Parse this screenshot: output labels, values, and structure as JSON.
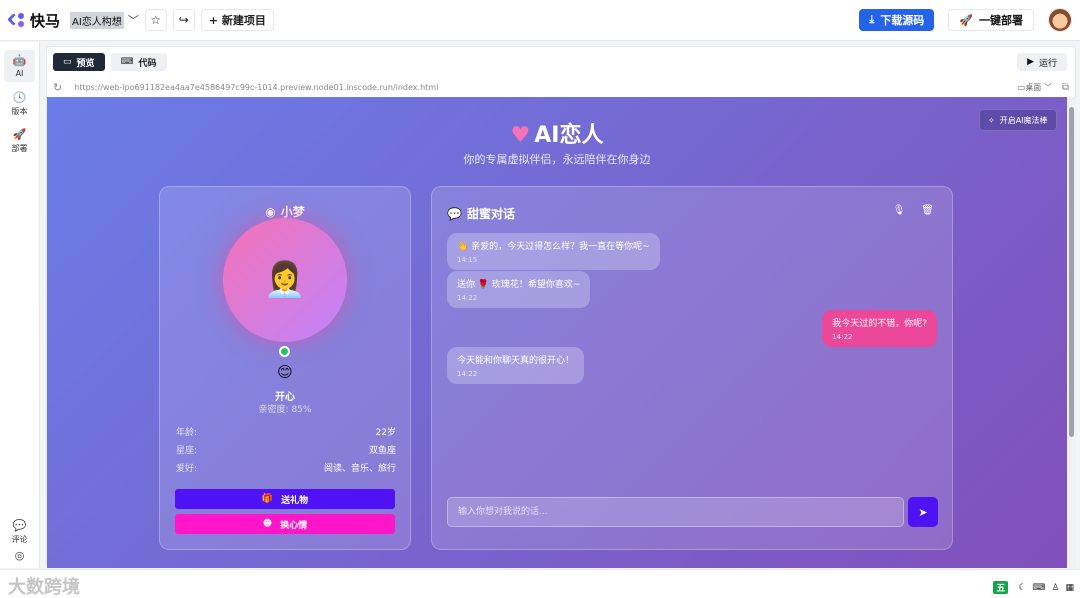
{
  "app": {
    "brand": "快马",
    "project_name": "AI恋人构想",
    "new_project": "+ 新建项目",
    "download": "下载源码",
    "deploy": "一键部署"
  },
  "rail": {
    "items": [
      {
        "label": "AI"
      },
      {
        "label": "版本"
      },
      {
        "label": "部署"
      },
      {
        "label": "评论"
      }
    ]
  },
  "editor": {
    "tabs": [
      {
        "label": "预览"
      },
      {
        "label": "代码"
      }
    ],
    "run": "运行",
    "url": "https://web-ipo691182ea4aa7e4586497c99c-1014.preview.node01.inscode.run/index.html",
    "device": "桌面"
  },
  "page": {
    "title": "AI恋人",
    "subtitle": "你的专属虚拟伴侣，永远陪伴在你身边",
    "magic_button": "开启AI魔法棒",
    "profile": {
      "name": "小梦",
      "mood": "开心",
      "intimacy": "亲密度: 85%",
      "info": [
        {
          "key": "年龄:",
          "value": "22岁"
        },
        {
          "key": "星座:",
          "value": "双鱼座"
        },
        {
          "key": "爱好:",
          "value": "阅读、音乐、旅行"
        }
      ],
      "gift_button": "送礼物",
      "mood_button": "换心情"
    },
    "chat": {
      "title": "甜蜜对话",
      "messages": [
        {
          "from": "ai",
          "text": "👋 亲爱的，今天过得怎么样？我一直在等你呢~",
          "time": "14:15"
        },
        {
          "from": "ai",
          "text": "送你 🌹 玫瑰花！希望你喜欢~",
          "time": "14:22"
        },
        {
          "from": "me",
          "text": "我今天过的不错，你呢?",
          "time": "14:22"
        },
        {
          "from": "ai",
          "text": "今天能和你聊天真的很开心！",
          "time": "14:22"
        }
      ],
      "input_placeholder": "输入你想对我说的话..."
    }
  },
  "bottom": {
    "watermark": "大数跨境",
    "ime": "五"
  },
  "colors": {
    "accent_blue": "#2563eb",
    "gift": "#4f12f5",
    "mood": "#ff16c8",
    "user_bubble": "#ec4899"
  }
}
